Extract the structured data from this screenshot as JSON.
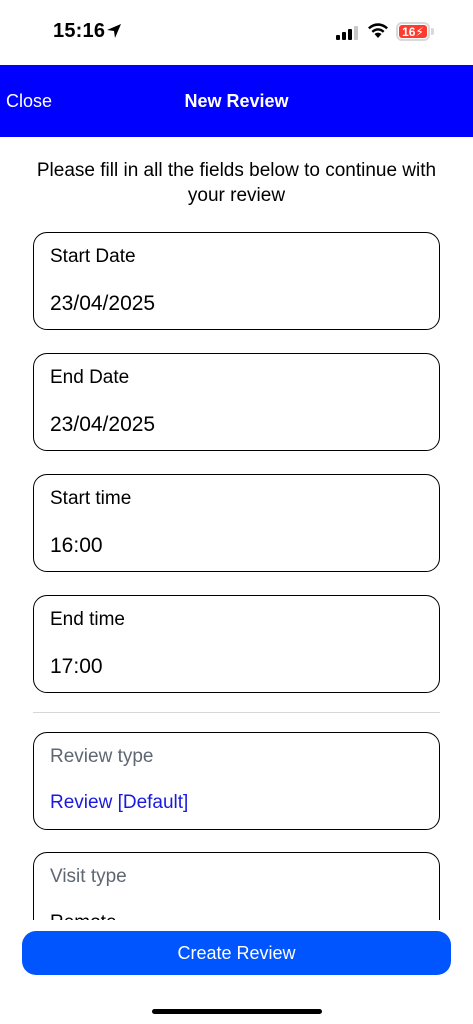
{
  "status_bar": {
    "time": "15:16",
    "battery": "16"
  },
  "nav": {
    "close_label": "Close",
    "title": "New Review"
  },
  "intro_text": "Please fill in all the fields below to continue with your review",
  "fields": {
    "start_date": {
      "label": "Start Date",
      "value": "23/04/2025"
    },
    "end_date": {
      "label": "End Date",
      "value": "23/04/2025"
    },
    "start_time": {
      "label": "Start time",
      "value": "16:00"
    },
    "end_time": {
      "label": "End time",
      "value": "17:00"
    },
    "review_type": {
      "label": "Review type",
      "value": "Review [Default]"
    },
    "visit_type": {
      "label": "Visit type",
      "value": "Remote"
    }
  },
  "create_button_label": "Create Review",
  "colors": {
    "nav": "#0000ff",
    "button": "#0055ff",
    "link_value": "#1a1adf",
    "battery": "#ff3b30"
  }
}
